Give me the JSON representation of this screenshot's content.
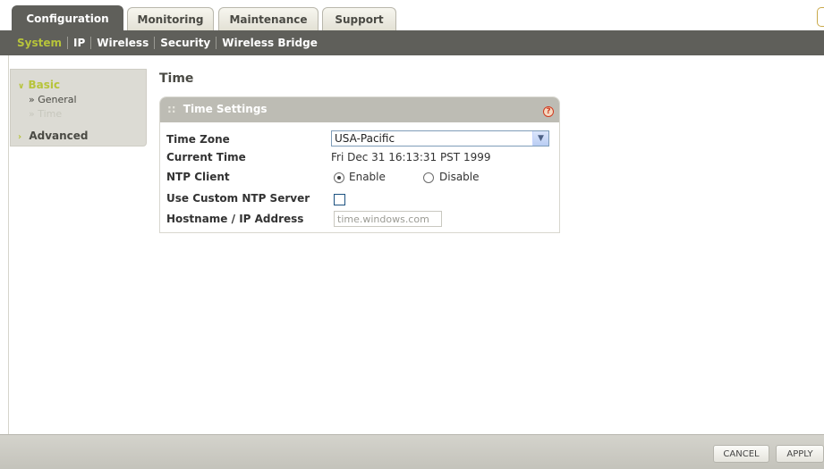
{
  "tabs": [
    {
      "label": "Configuration",
      "active": true
    },
    {
      "label": "Monitoring",
      "active": false
    },
    {
      "label": "Maintenance",
      "active": false
    },
    {
      "label": "Support",
      "active": false
    }
  ],
  "subnav": [
    {
      "label": "System",
      "active": true
    },
    {
      "label": "IP",
      "active": false
    },
    {
      "label": "Wireless",
      "active": false
    },
    {
      "label": "Security",
      "active": false
    },
    {
      "label": "Wireless Bridge",
      "active": false
    }
  ],
  "sidebar": {
    "basic_label": "Basic",
    "general_label": "» General",
    "time_label": "» Time",
    "advanced_label": "Advanced"
  },
  "page_title": "Time",
  "panel": {
    "title": "Time Settings",
    "time_zone_label": "Time Zone",
    "time_zone_value": "USA-Pacific",
    "current_time_label": "Current Time",
    "current_time_value": "Fri Dec 31 16:13:31 PST 1999",
    "ntp_client_label": "NTP Client",
    "ntp_enable_label": "Enable",
    "ntp_disable_label": "Disable",
    "custom_ntp_label": "Use Custom NTP Server",
    "hostname_label": "Hostname / IP Address",
    "hostname_value": "time.windows.com"
  },
  "buttons": {
    "cancel": "CANCEL",
    "apply": "APPLY"
  },
  "colors": {
    "accent": "#b7c43a",
    "nav_bg": "#5f5f5a",
    "help": "#d03a1f"
  }
}
